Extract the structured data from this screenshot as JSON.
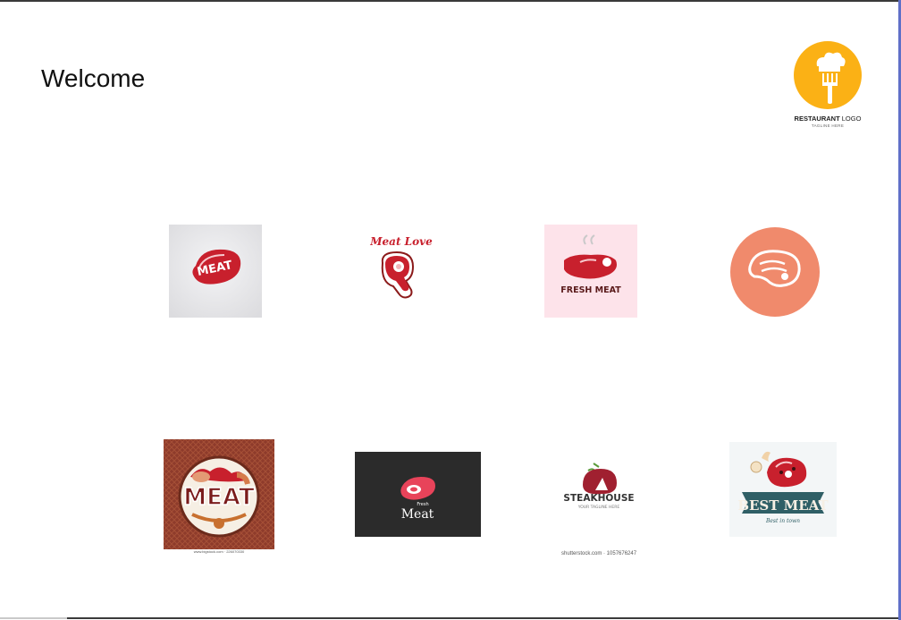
{
  "page": {
    "welcome_text": "Welcome",
    "brand": {
      "name_bold": "RESTAURANT",
      "name_rest": "LOGO",
      "tagline": "TAGLINE HERE",
      "icon": "chef-hat-fork-icon",
      "accent": "#fbb115"
    }
  },
  "gallery": {
    "tiles": [
      {
        "id": "meat-steak-oval",
        "text": "MEAT"
      },
      {
        "id": "meat-love",
        "text": "Meat Love"
      },
      {
        "id": "fresh-meat",
        "text": "FRESH MEAT"
      },
      {
        "id": "steak-circle",
        "text": ""
      },
      {
        "id": "meat-badge",
        "text": "MEAT",
        "credit": "www.bigstock.com · 226070330"
      },
      {
        "id": "fresh-meat-dark",
        "text_top": "Fresh",
        "text": "Meat"
      },
      {
        "id": "steakhouse",
        "text": "STEAKHOUSE",
        "subtext": "YOUR TAGLINE HERE",
        "credit": "shutterstock.com · 1057676247"
      },
      {
        "id": "best-meat",
        "text": "BEST MEAT",
        "subtext": "Best in town"
      }
    ]
  },
  "colors": {
    "meat_red": "#c8202d",
    "dark_red": "#8b1a1a",
    "salmon": "#f08a6c",
    "pink_bg": "#fde3ea",
    "teal": "#2f5f66"
  }
}
